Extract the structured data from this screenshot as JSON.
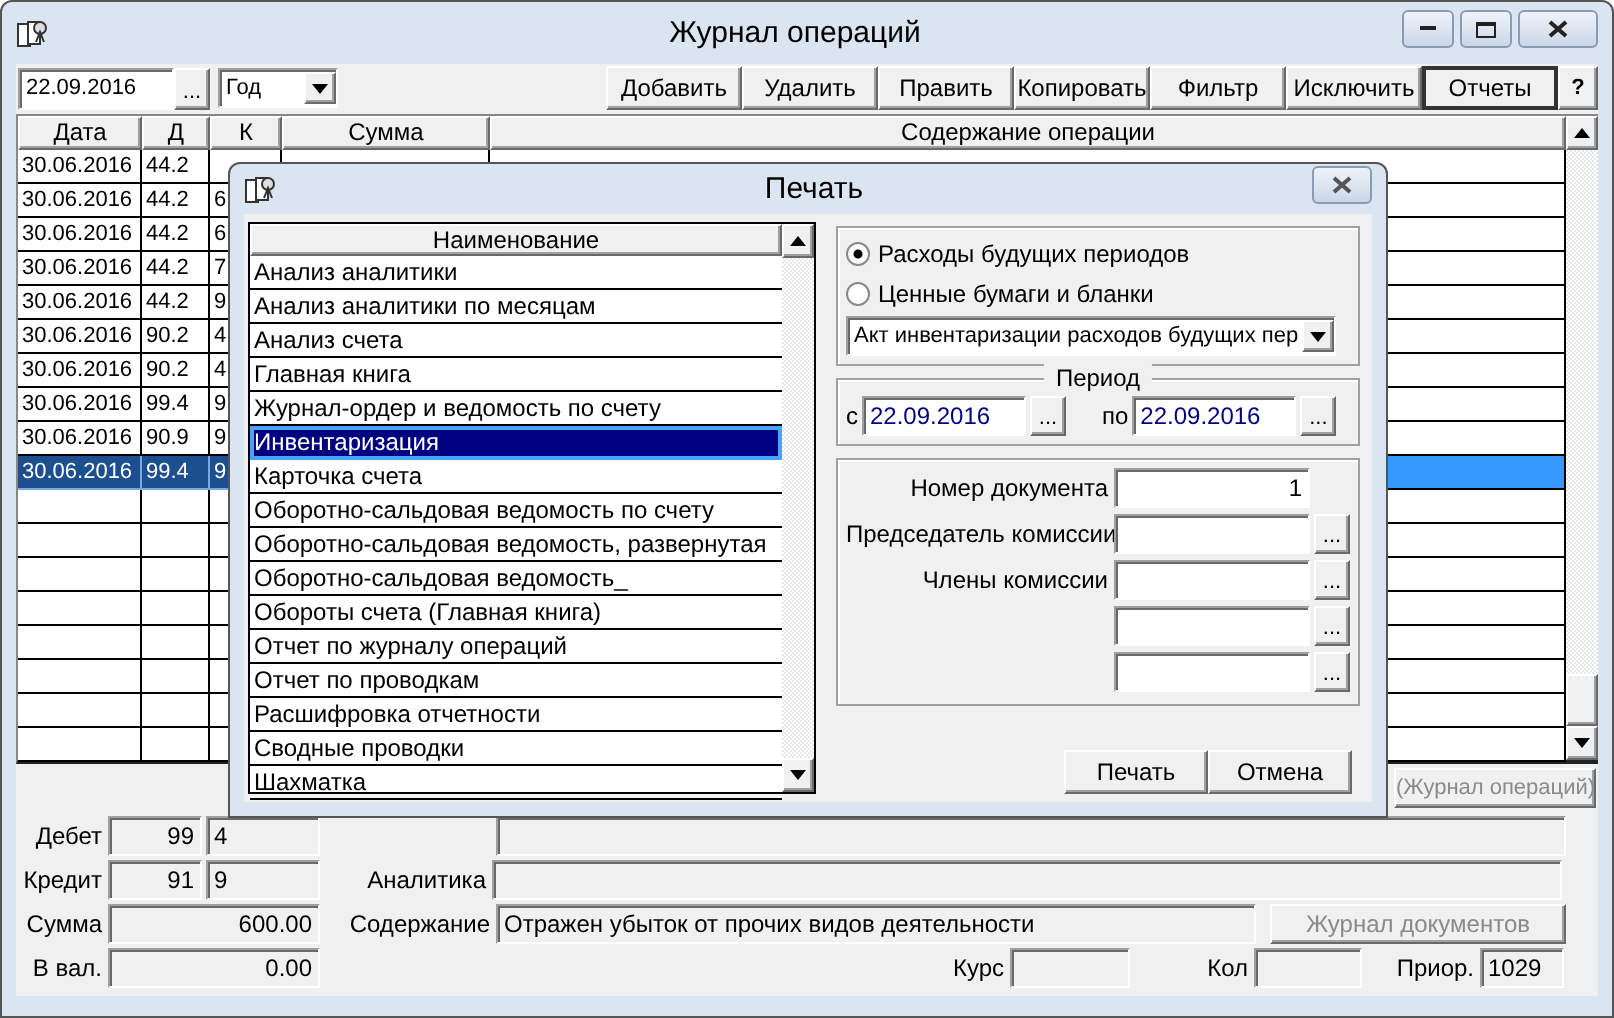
{
  "window": {
    "title": "Журнал операций"
  },
  "toolbar": {
    "date": "22.09.2016",
    "browse": "...",
    "period": "Год",
    "buttons": [
      {
        "label": "Добавить",
        "pressed": false
      },
      {
        "label": "Удалить",
        "pressed": false
      },
      {
        "label": "Править",
        "pressed": false
      },
      {
        "label": "Копировать",
        "pressed": false
      },
      {
        "label": "Фильтр",
        "pressed": false
      },
      {
        "label": "Исключить",
        "pressed": false
      },
      {
        "label": "Отчеты",
        "pressed": true
      }
    ],
    "help": "?"
  },
  "table": {
    "columns": [
      "Дата",
      "Д",
      "К",
      "Сумма",
      "Содержание операции"
    ],
    "rows": [
      {
        "date": "30.06.2016",
        "debit": "44.2",
        "selected": false
      },
      {
        "date": "30.06.2016",
        "debit": "44.2",
        "credit": "6",
        "selected": false
      },
      {
        "date": "30.06.2016",
        "debit": "44.2",
        "credit": "6",
        "selected": false
      },
      {
        "date": "30.06.2016",
        "debit": "44.2",
        "credit": "7",
        "selected": false
      },
      {
        "date": "30.06.2016",
        "debit": "44.2",
        "credit": "9",
        "selected": false
      },
      {
        "date": "30.06.2016",
        "debit": "90.2",
        "credit": "4",
        "selected": false
      },
      {
        "date": "30.06.2016",
        "debit": "90.2",
        "credit": "4",
        "selected": false
      },
      {
        "date": "30.06.2016",
        "debit": "99.4",
        "credit": "9",
        "selected": false
      },
      {
        "date": "30.06.2016",
        "debit": "90.9",
        "credit": "9",
        "selected": false
      },
      {
        "date": "30.06.2016",
        "debit": "99.4",
        "credit": "9",
        "selected": true
      }
    ]
  },
  "journal_button": "(Журнал операций)",
  "details": {
    "debit_label": "Дебет",
    "debit_account": "99",
    "debit_sub": "4",
    "credit_label": "Кредит",
    "credit_account": "91",
    "credit_sub": "9",
    "analytics_label": "Аналитика",
    "sum_label": "Сумма",
    "sum": "600.00",
    "content_label": "Содержание",
    "content": "Отражен убыток от прочих видов деятельности",
    "documents_button": "Журнал документов",
    "currency_label": "В вал.",
    "currency": "0.00",
    "rate_label": "Курс",
    "qty_label": "Кол",
    "priority_label": "Приор.",
    "priority": "1029"
  },
  "dialog": {
    "title": "Печать",
    "list": {
      "header": "Наименование",
      "items": [
        {
          "label": "Анализ аналитики",
          "selected": false
        },
        {
          "label": "Анализ аналитики по месяцам",
          "selected": false
        },
        {
          "label": "Анализ счета",
          "selected": false
        },
        {
          "label": "Главная книга",
          "selected": false
        },
        {
          "label": "Журнал-ордер и ведомость по счету",
          "selected": false
        },
        {
          "label": "Инвентаризация",
          "selected": true
        },
        {
          "label": "Карточка счета",
          "selected": false
        },
        {
          "label": "Оборотно-сальдовая ведомость по счету",
          "selected": false
        },
        {
          "label": "Оборотно-сальдовая ведомость, развернутая",
          "selected": false
        },
        {
          "label": "Оборотно-сальдовая ведомость_",
          "selected": false
        },
        {
          "label": "Обороты счета (Главная книга)",
          "selected": false
        },
        {
          "label": "Отчет по журналу операций",
          "selected": false
        },
        {
          "label": "Отчет по проводкам",
          "selected": false
        },
        {
          "label": "Расшифровка отчетности",
          "selected": false
        },
        {
          "label": "Сводные проводки",
          "selected": false
        },
        {
          "label": "Шахматка",
          "selected": false
        }
      ]
    },
    "radios": [
      {
        "label": "Расходы будущих периодов",
        "selected": true
      },
      {
        "label": "Ценные бумаги и бланки",
        "selected": false
      }
    ],
    "form_select": "Акт инвентаризации расходов будущих пер",
    "period": {
      "legend": "Период",
      "from_label": "с",
      "from": "22.09.2016",
      "from_browse": "...",
      "to_label": "по",
      "to": "22.09.2016",
      "to_browse": "..."
    },
    "fields": [
      {
        "label": "Номер документа",
        "value": "1"
      },
      {
        "label": "Председатель комиссии",
        "browse": "..."
      },
      {
        "label": "Члены комиссии",
        "browse": "..."
      },
      {
        "browse": "..."
      },
      {
        "browse": "..."
      }
    ],
    "buttons": [
      "Печать",
      "Отмена"
    ]
  }
}
